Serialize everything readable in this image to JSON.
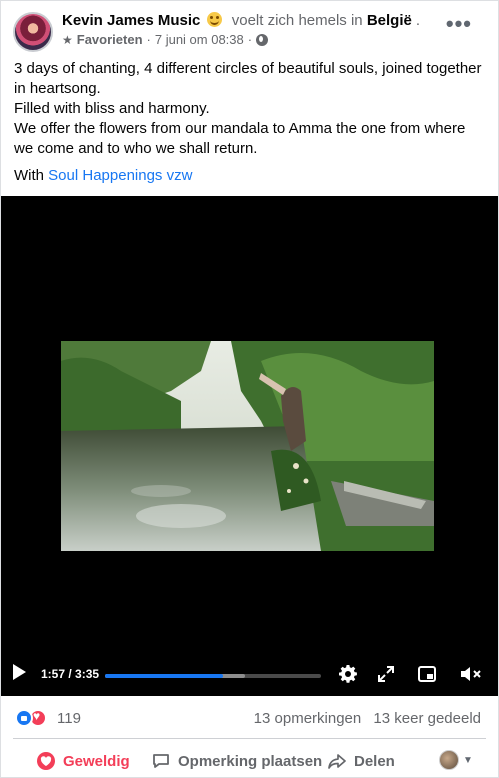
{
  "header": {
    "author": "Kevin James Music",
    "activity": "voelt zich hemels in",
    "place": "België",
    "audience_label": "Favorieten",
    "date": "7 juni om 08:38",
    "separator": "·",
    "more_label": "•••"
  },
  "post": {
    "lines": [
      "3 days of chanting, 4 different circles of beautiful souls, joined together in heartsong.",
      "Filled with bliss and harmony.",
      "We offer the flowers from our mandala to Amma the one from where we come and to who we shall return."
    ],
    "with_prefix": "With",
    "with_tag": "Soul Happenings vzw"
  },
  "video": {
    "time": "1:57 / 3:35",
    "progress_fraction": 0.545,
    "buffered_fraction": 0.65
  },
  "reactions": {
    "count": "119",
    "comments": "13 opmerkingen",
    "shares": "13 keer gedeeld"
  },
  "actions": {
    "like": "Geweldig",
    "comment": "Opmerking plaatsen",
    "share": "Delen"
  },
  "colors": {
    "accent": "#1877f2",
    "love": "#f33e58",
    "secondary_text": "#65676b"
  }
}
